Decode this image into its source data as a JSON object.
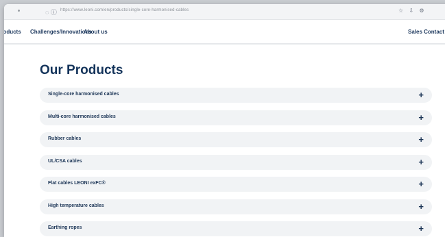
{
  "browser": {
    "url": "https://www.leoni.com/en/products/single-core-harmonised-cables",
    "toolbar_icons": "☆ ⇩ ⚙"
  },
  "nav": {
    "items": [
      "Products",
      "Challenges/Innovations",
      "About us"
    ],
    "sales_contact": "Sales Contact"
  },
  "page": {
    "title": "Our Products"
  },
  "products": [
    "Single-core harmonised cables",
    "Multi-core harmonised cables",
    "Rubber cables",
    "UL/CSA cables",
    "Flat cables LEONI exFC®",
    "High temperature cables",
    "Earthing ropes"
  ],
  "expand_icon": "+"
}
